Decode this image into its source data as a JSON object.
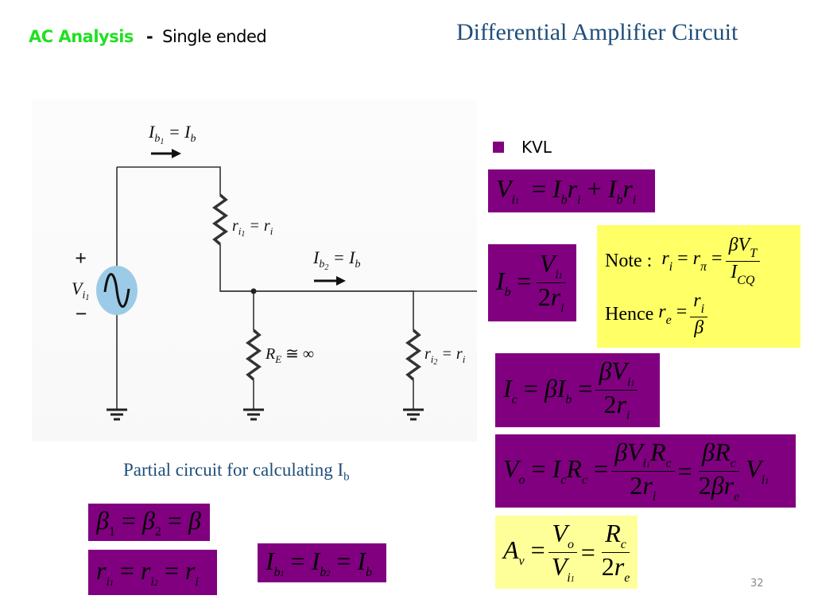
{
  "header": {
    "section": "AC Analysis",
    "separator": "-",
    "subtitle": "Single ended",
    "title": "Differential Amplifier Circuit"
  },
  "circuit": {
    "label_ib1": "I_b1 = I_b",
    "label_ri1": "r_i1 = r_i",
    "label_ib2": "I_b2 = I_b",
    "label_re": "R_E ≅ ∞",
    "label_ri2": "r_i2 = r_i",
    "label_source": "V_i1",
    "plus": "+",
    "minus": "−",
    "source_color": "#9ccbe8"
  },
  "caption": {
    "text": "Partial circuit for calculating I",
    "subscript": "b"
  },
  "bullet": {
    "label": "KVL",
    "color": "#800080"
  },
  "equations": {
    "kvl": "V_i1 = I_b r_i + I_b r_i",
    "ib": "I_b = V_i1 / 2r_i",
    "note_label": "Note :",
    "note": "r_i = r_π = βV_T / I_CQ",
    "hence_label": "Hence",
    "hence": "r_e = r_i / β",
    "ic": "I_c = βI_b = βV_i1 / 2r_i",
    "vo": "V_o = I_c R_c = βV_i1 R_c / 2r_i = βR_c / 2βr_e · V_i1",
    "av": "A_v = V_o / V_i1 = R_c / 2r_e",
    "beta": "β1 = β2 = β",
    "ri": "r_i1 = r_i2 = r_i",
    "ibeq": "I_b1 = I_b2 = I_b"
  },
  "colors": {
    "purple": "#800080",
    "yellow": "#ffff66",
    "pale_yellow": "#ffff99",
    "title_blue": "#1f4e79",
    "green": "#22e022"
  },
  "footer": {
    "page_number": "32"
  }
}
